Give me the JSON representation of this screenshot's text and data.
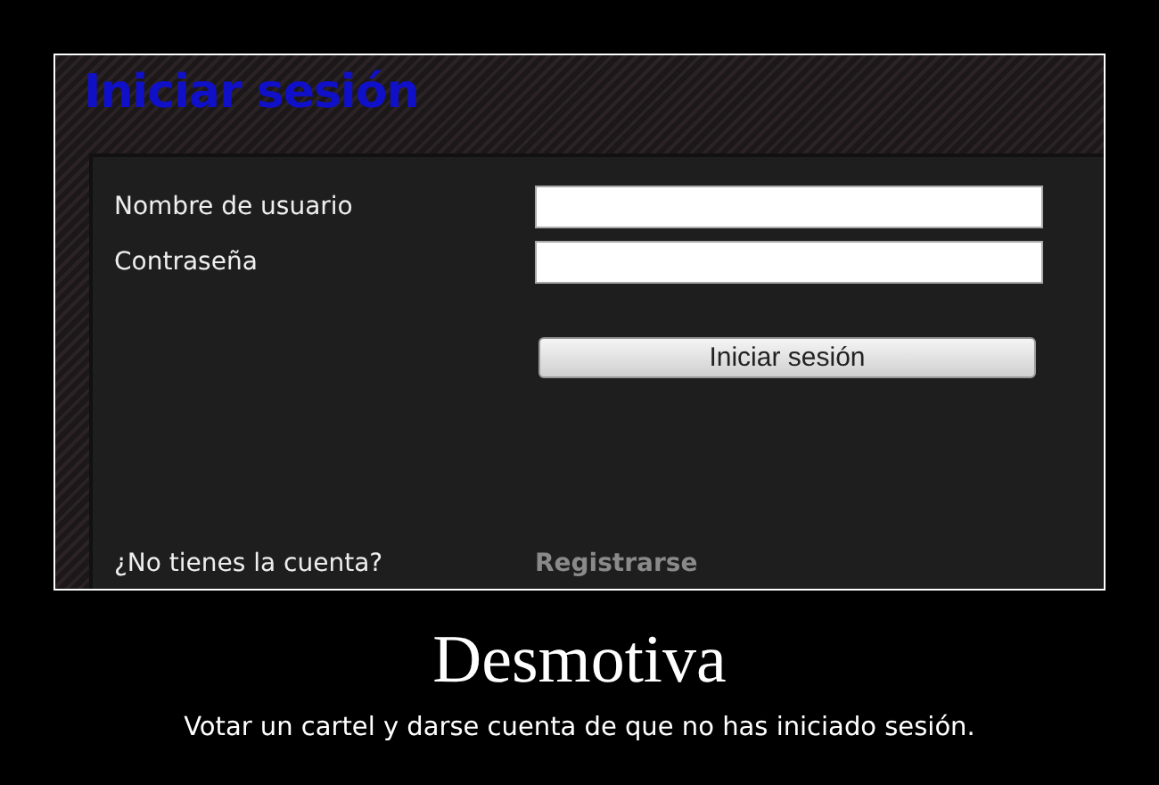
{
  "title": "Iniciar sesión",
  "fields": [
    {
      "label": "Nombre de usuario"
    },
    {
      "label": "Contraseña"
    }
  ],
  "submit_button": "Iniciar sesión",
  "register": {
    "prompt": "¿No tienes la cuenta?",
    "link": "Registrarse"
  },
  "caption": {
    "title": "Desmotiva",
    "text": "Votar un cartel y darse cuenta de que no has iniciado sesión."
  }
}
